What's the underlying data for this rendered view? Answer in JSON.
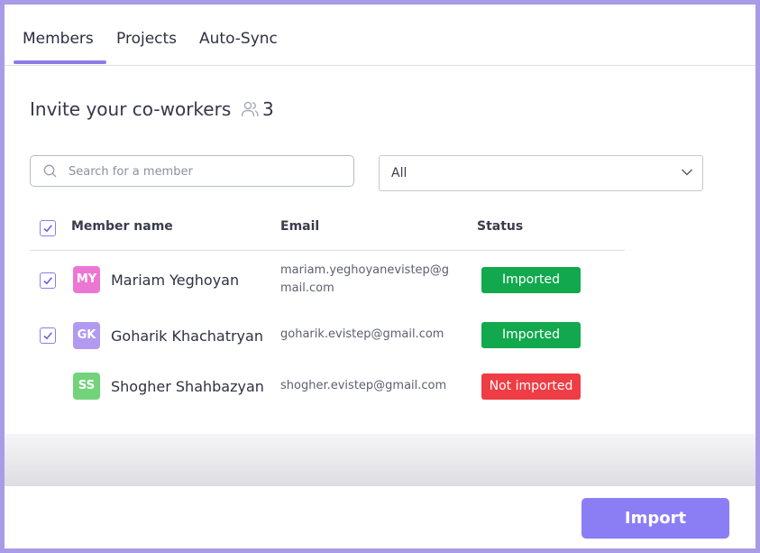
{
  "tabs": [
    {
      "label": "Members",
      "active": true
    },
    {
      "label": "Projects",
      "active": false
    },
    {
      "label": "Auto-Sync",
      "active": false
    }
  ],
  "invite": {
    "title": "Invite your co-workers",
    "count": "3",
    "icon": "users-icon"
  },
  "search": {
    "placeholder": "Search for a member",
    "value": ""
  },
  "filter": {
    "selected": "All"
  },
  "table": {
    "columns": [
      "Member name",
      "Email",
      "Status"
    ],
    "header_checked": true,
    "rows": [
      {
        "checked": true,
        "initials": "MY",
        "name": "Mariam Yeghoyan",
        "email_line1": "mariam.yeghoyanevistep@g",
        "email_line2": "mail.com",
        "status": "Imported",
        "avatar_color": "#ec76d4"
      },
      {
        "checked": true,
        "initials": "GK",
        "name": "Goharik Khachatryan",
        "email_line1": "goharik.evistep@gmail.com",
        "email_line2": "",
        "status": "Imported",
        "avatar_color": "#b19af0"
      },
      {
        "checked": false,
        "initials": "SS",
        "name": "Shogher Shahbazyan",
        "email_line1": "shogher.evistep@gmail.com",
        "email_line2": "",
        "status": "Not imported",
        "avatar_color": "#72d37b"
      }
    ]
  },
  "colors": {
    "accent": "#8b7de8",
    "imported": "#11a84e",
    "not_imported": "#ee3d44",
    "import_button": "#8b7ef5"
  },
  "footer": {
    "import_label": "Import"
  }
}
